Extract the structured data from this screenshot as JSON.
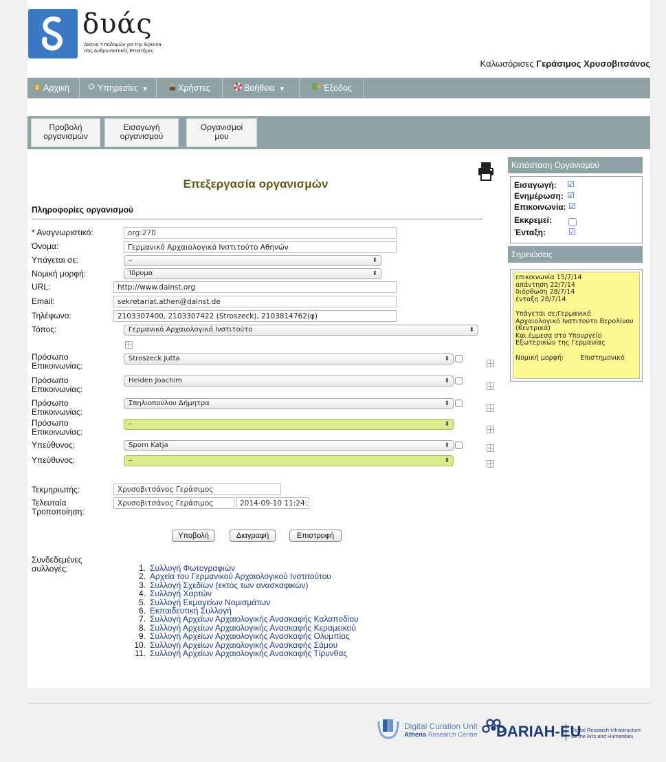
{
  "header": {
    "brand": "δυάς",
    "brand_sub_1": "Δίκτυο Υποδομών για την Έρευνα",
    "brand_sub_2": "στις Ανθρωπιστικές Επιστήμες",
    "welcome_prefix": "Καλωσόρισες",
    "welcome_user": "Γεράσιμος Χρυσοβιτσάνος"
  },
  "nav": {
    "home": "Αρχική",
    "services": "Υπηρεσίες",
    "users": "Χρήστες",
    "help": "Βοήθεια",
    "logout": "Έξοδος"
  },
  "subtabs": {
    "view_1": "Προβολή",
    "view_2": "οργανισμών",
    "insert_1": "Εισαγωγή",
    "insert_2": "οργανισμού",
    "mine_1": "Οργανισμοί",
    "mine_2": "μου"
  },
  "main": {
    "title": "Επεξεργασία οργανισμών",
    "section": "Πληροφορίες οργανισμού"
  },
  "form": {
    "id_label": "* Αναγνωριστικό:",
    "id_value": "org:270",
    "name_label": "Όνομα:",
    "name_value": "Γερμανικό Αρχαιολογικό Ινστιτούτο Αθηνών",
    "parent_label": "Υπάγεται σε:",
    "parent_value": "–",
    "legal_label": "Νομική μορφή:",
    "legal_value": "Ίδρυμα",
    "url_label": "URL:",
    "url_value": "http://www.dainst.org",
    "email_label": "Email:",
    "email_value": "sekretariat.athen@dainst.de",
    "phone_label": "Τηλέφωνο:",
    "phone_value": "2103307400, 2103307422 (Stroszeck), 2103814762(φ)",
    "place_label": "Τόπος:",
    "place_value": "Γερμανικό Αρχαιολογικό Ινστιτούτο",
    "contact_label_1": "Πρόσωπο",
    "contact_label_2": "Επικοινωνίας:",
    "contact_1": "Stroszeck Jutta",
    "contact_2": "Heiden Joachim",
    "contact_3": "Σπηλιοπούλου Δήμητρα",
    "contact_4": "–",
    "resp_label": "Υπεύθυνος:",
    "resp_1": "Sporn Katja",
    "resp_2": "–",
    "doc_label": "Τεκμηριωτής:",
    "doc_value": "Χρυσοβιτσάνος Γεράσιμος",
    "mod_label_1": "Τελευταία",
    "mod_label_2": "Τροποποίηση:",
    "mod_user": "Χρυσοβιτσάνος Γεράσιμος",
    "mod_date": "2014-09-10 11:24:"
  },
  "buttons": {
    "submit": "Υποβολή",
    "delete": "Διαγραφή",
    "back": "Επιστροφή"
  },
  "collections": {
    "label_1": "Συνδεδεμένες",
    "label_2": "συλλογές:",
    "items": [
      "Συλλογή Φωτογραφιών",
      "Αρχεία του Γερμανικού Αρχαιολογικού Ινστιτούτου",
      "Συλλογή Σχεδίων (εκτός των ανασκαφικών)",
      "Συλλογή Χαρτών",
      "Συλλογή Εκμαγείων Νομισμάτων",
      "Εκπαιδευτική Συλλογή",
      "Συλλογή Αρχείων Αρχαιολογικής Ανασκαφής Καλαποδίου",
      "Συλλογή Αρχείων Αρχαιολογικής Ανασκαφής Κεραμεικού",
      "Συλλογή Αρχείων Αρχαιολογικής Ανασκαφής Ολυμπίας",
      "Συλλογή Αρχείων Αρχαιολογικής Ανασκαφής Σάμου",
      "Συλλογή Αρχείων Αρχαιολογικής Ανασκαφής Τίρυνθας"
    ],
    "numbers": [
      "1.",
      "2.",
      "3.",
      "4.",
      "5.",
      "6.",
      "7.",
      "8.",
      "9.",
      "10.",
      "11."
    ]
  },
  "status_panel": {
    "title": "Κατάσταση Οργανισμού",
    "insert": "Εισαγωγή:",
    "update": "Ενημέρωση:",
    "contact": "Επικοινωνία:",
    "pending": "Εκκρεμεί:",
    "inclusion": "Ένταξη:"
  },
  "notes_panel": {
    "title": "Σημειώσεις",
    "lines": [
      "επικοινωνία 15/7/14",
      "απάντηση 22/7/14",
      "διόρθωση 28/7/14",
      "ένταξη 28/7/14",
      "",
      "Υπάγεται σε:Γερμανικό",
      "Αρχαιολογικό Ινστιτούτο Βερολίνου",
      "(Κεντρικά)",
      "Και έμμεσα στο Υπουργείο",
      "Εξωτερικών της Γερμανίας",
      "",
      "Νομική μορφή:        Επιστημονικό"
    ]
  },
  "footer": {
    "dcu_1": "Digital Curation Unit",
    "dcu_2a": "Athena",
    "dcu_2b": " Research Centre",
    "dariah": "DARIAH-EU",
    "dariah_sub_1": "Digital Research Infrastructure",
    "dariah_sub_2": "for the Arts and Humanities"
  },
  "colors": {
    "nav_bg": "#8fa3a6",
    "logo_blue": "#3b79c4",
    "title_olive": "#5d5a19",
    "notes_yellow": "#fcf893",
    "select_green": "#d9ec8c"
  }
}
